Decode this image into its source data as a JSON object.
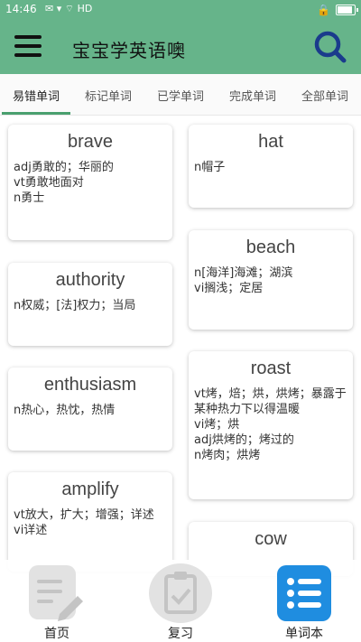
{
  "status_bar": {
    "time": "14:46",
    "network": "HD"
  },
  "header": {
    "title": "宝宝学英语噢"
  },
  "tabs": [
    {
      "label": "易错单词",
      "active": true
    },
    {
      "label": "标记单词"
    },
    {
      "label": "已学单词"
    },
    {
      "label": "完成单词"
    },
    {
      "label": "全部单词"
    }
  ],
  "cards": [
    {
      "word": "brave",
      "lines": [
        "adj勇敢的；华丽的",
        "vt勇敢地面对",
        "n勇士"
      ]
    },
    {
      "word": "hat",
      "lines": [
        "n帽子"
      ]
    },
    {
      "word": "authority",
      "lines": [
        "n权威；[法]权力；当局"
      ]
    },
    {
      "word": "beach",
      "lines": [
        "n[海洋]海滩；湖滨",
        "vi搁浅；定居"
      ]
    },
    {
      "word": "enthusiasm",
      "lines": [
        "n热心，热忱，热情"
      ]
    },
    {
      "word": "roast",
      "lines": [
        "vt烤，焙；烘，烘烤；暴露于某种热力下以得温暖",
        "vi烤；烘",
        "adj烘烤的；烤过的",
        "n烤肉；烘烤"
      ]
    },
    {
      "word": "amplify",
      "lines": [
        "vt放大，扩大；增强；详述",
        "vi详述"
      ]
    },
    {
      "word": "cow",
      "lines": []
    }
  ],
  "bottom_nav": [
    {
      "label": "首页",
      "icon": "edit-note-icon"
    },
    {
      "label": "复习",
      "icon": "clipboard-check-icon"
    },
    {
      "label": "单词本",
      "icon": "list-icon",
      "active": true
    }
  ],
  "colors": {
    "primary": "#66b48a",
    "indicator": "#4aa06f",
    "active_nav": "#1f8de0"
  }
}
